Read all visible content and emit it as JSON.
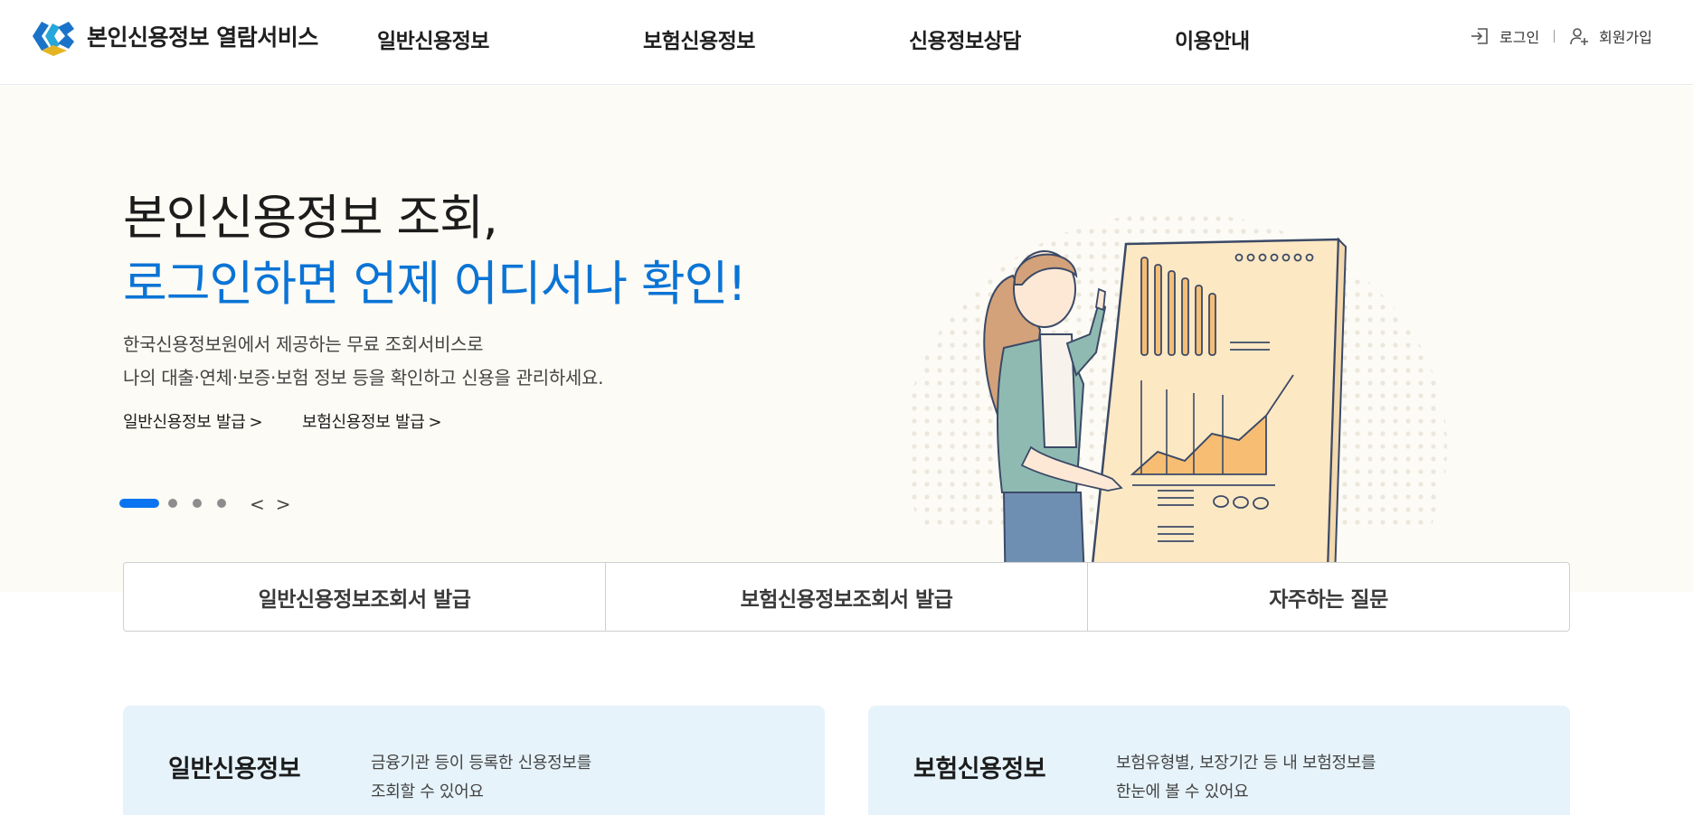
{
  "brand": {
    "title": "본인신용정보 열람서비스",
    "logo_icon": "cis-logo"
  },
  "gnb": [
    {
      "label": "일반신용정보"
    },
    {
      "label": "보험신용정보"
    },
    {
      "label": "신용정보상담"
    },
    {
      "label": "이용안내"
    }
  ],
  "util": {
    "login_label": "로그인",
    "login_icon": "login-icon",
    "signup_label": "회원가입",
    "signup_icon": "user-add-icon"
  },
  "hero": {
    "title_line1": "본인신용정보 조회,",
    "title_line2": "로그인하면 언제 어디서나 확인!",
    "desc_line1": "한국신용정보원에서 제공하는 무료 조회서비스로",
    "desc_line2": "나의 대출·연체·보증·보험 정보 등을 확인하고 신용을 관리하세요.",
    "link1": "일반신용정보 발급",
    "link2": "보험신용정보 발급",
    "chevron": ">",
    "prev": "<",
    "next": ">",
    "slide_count": 4,
    "active_slide": 1
  },
  "quick": [
    {
      "label": "일반신용정보조회서 발급"
    },
    {
      "label": "보험신용정보조회서 발급"
    },
    {
      "label": "자주하는 질문"
    }
  ],
  "cards": [
    {
      "title": "일반신용정보",
      "desc_line1": "금융기관 등이 등록한 신용정보를",
      "desc_line2": "조회할 수 있어요"
    },
    {
      "title": "보험신용정보",
      "desc_line1": "보험유형별, 보장기간 등 내 보험정보를",
      "desc_line2": "한눈에 볼 수 있어요"
    }
  ],
  "colors": {
    "accent": "#0a74d6",
    "hero_bg": "#fdfbf5",
    "card_bg": "#e6f3fb"
  }
}
